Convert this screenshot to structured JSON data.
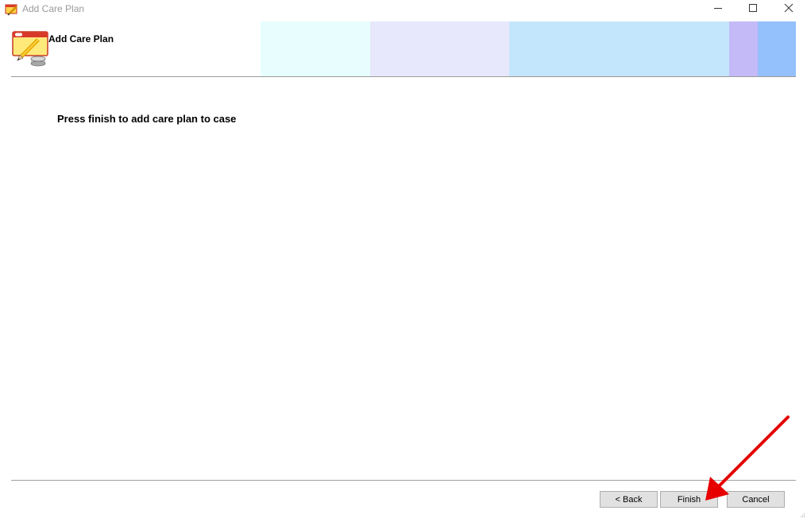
{
  "window": {
    "title": "Add Care Plan",
    "controls": [
      "minimize-icon",
      "maximize-icon",
      "close-icon"
    ]
  },
  "header": {
    "title": "Add Care Plan",
    "icon": "care-plan-icon",
    "band_colors": [
      "#e8fefe",
      "#e8e8fc",
      "#c4e6fc",
      "#c4baf8",
      "#94c0fc"
    ]
  },
  "body": {
    "message": "Press finish to add care plan to case"
  },
  "footer": {
    "back_label": "< Back",
    "finish_label": "Finish",
    "cancel_label": "Cancel"
  },
  "annotation": {
    "arrow_color": "#e60000",
    "points_to": "Finish"
  }
}
